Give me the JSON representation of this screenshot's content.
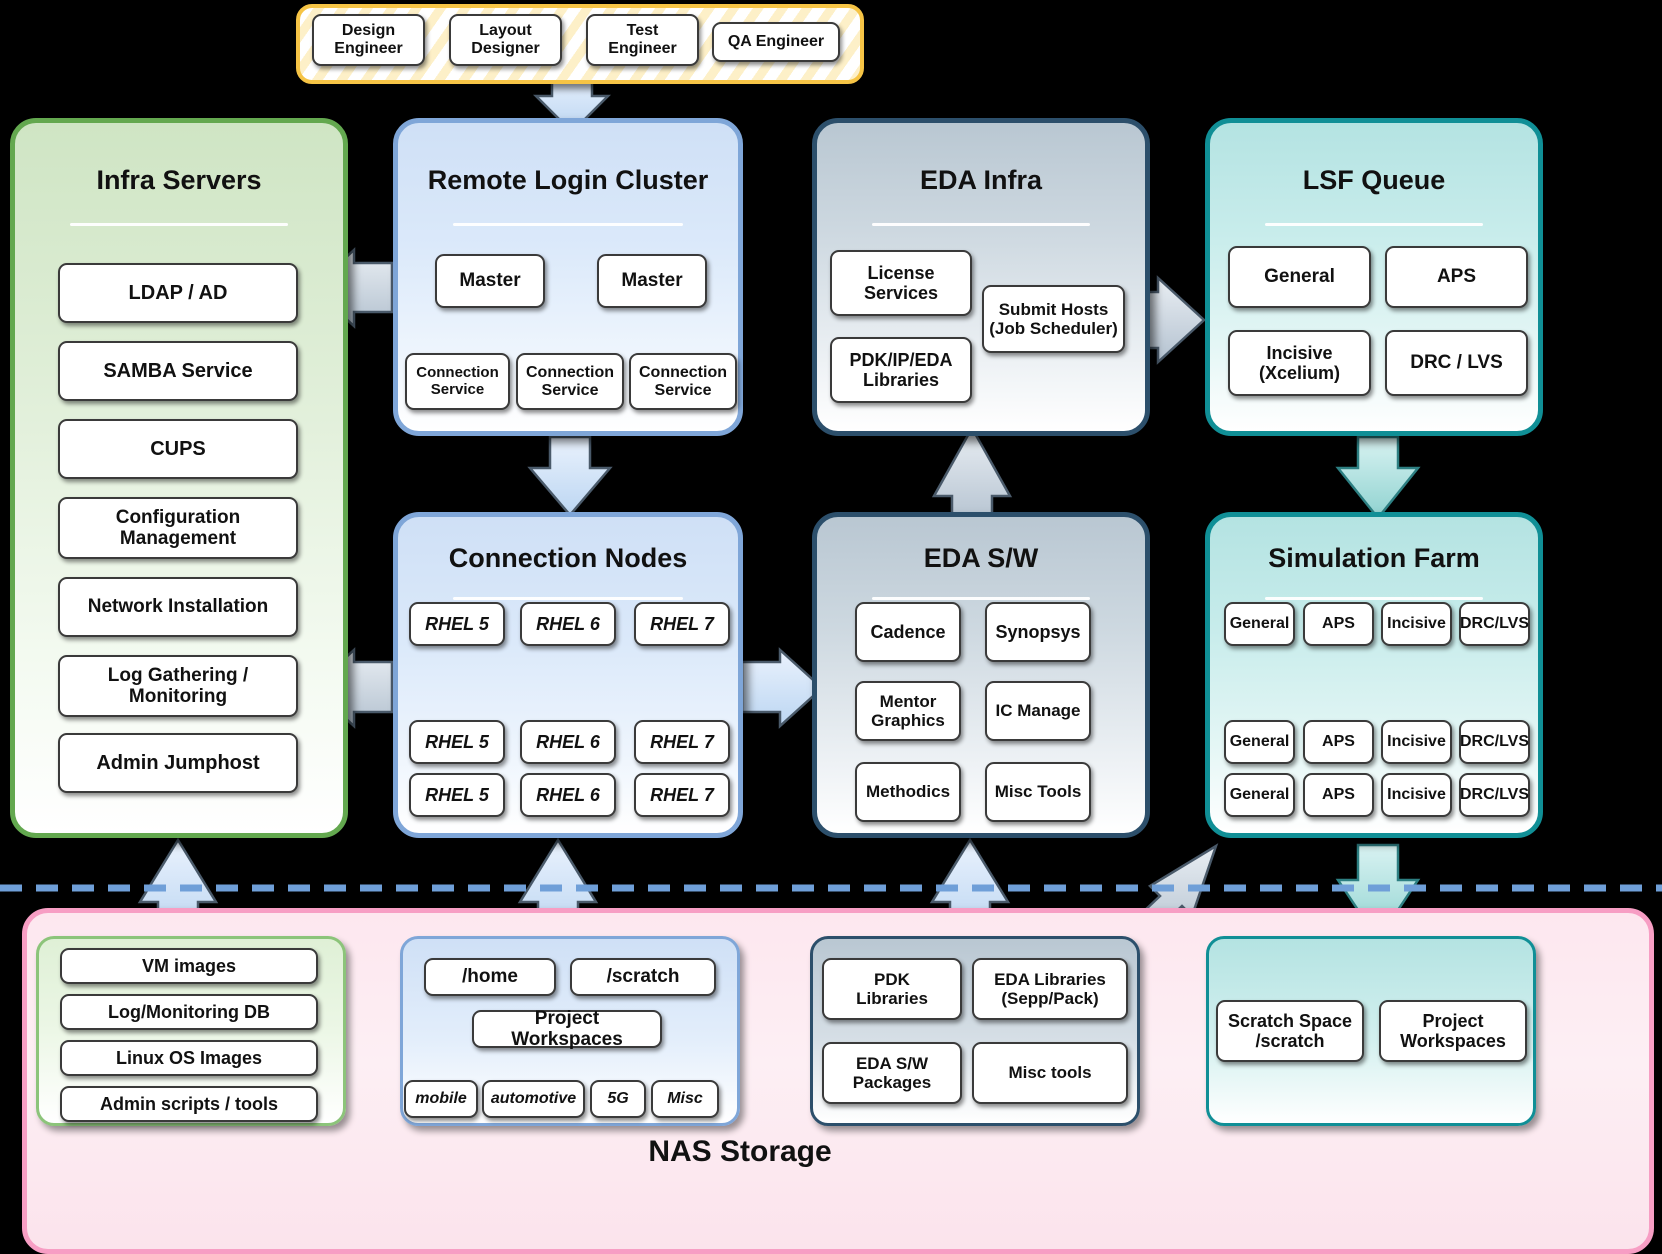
{
  "personas": {
    "items": [
      {
        "label": "Design\nEngineer"
      },
      {
        "label": "Layout\nDesigner"
      },
      {
        "label": "Test\nEngineer"
      },
      {
        "label": "QA Engineer"
      }
    ]
  },
  "panels": {
    "infra_servers": {
      "title": "Infra Servers",
      "items": [
        "LDAP / AD",
        "SAMBA Service",
        "CUPS",
        "Configuration\nManagement",
        "Network Installation",
        "Log Gathering /\nMonitoring",
        "Admin Jumphost"
      ]
    },
    "remote_login_cluster": {
      "title": "Remote Login Cluster",
      "masters": [
        "Master",
        "Master"
      ],
      "connection_services": [
        "Connection\nService",
        "Connection\nService",
        "Connection\nService"
      ]
    },
    "eda_infra": {
      "title": "EDA Infra",
      "items": [
        "License\nServices",
        "PDK/IP/EDA\nLibraries",
        "Submit Hosts\n(Job Scheduler)"
      ]
    },
    "lsf_queue": {
      "title": "LSF Queue",
      "items": [
        "General",
        "APS",
        "Incisive\n(Xcelium)",
        "DRC / LVS"
      ]
    },
    "connection_nodes": {
      "title": "Connection Nodes",
      "columns": [
        {
          "nodes": [
            "RHEL 5",
            "RHEL 5",
            "RHEL 5"
          ]
        },
        {
          "nodes": [
            "RHEL 6",
            "RHEL 6",
            "RHEL 6"
          ]
        },
        {
          "nodes": [
            "RHEL 7",
            "RHEL 7",
            "RHEL 7"
          ]
        }
      ]
    },
    "eda_sw": {
      "title": "EDA S/W",
      "items": [
        "Cadence",
        "Synopsys",
        "Mentor\nGraphics",
        "IC Manage",
        "Methodics",
        "Misc Tools"
      ]
    },
    "simulation_farm": {
      "title": "Simulation Farm",
      "columns": [
        {
          "nodes": [
            "General",
            "General",
            "General"
          ]
        },
        {
          "nodes": [
            "APS",
            "APS",
            "APS"
          ]
        },
        {
          "nodes": [
            "Incisive",
            "Incisive",
            "Incisive"
          ]
        },
        {
          "nodes": [
            "DRC/LVS",
            "DRC/LVS",
            "DRC/LVS"
          ]
        }
      ]
    }
  },
  "nas": {
    "title": "NAS Storage",
    "infra_group": {
      "items": [
        "VM images",
        "Log/Monitoring DB",
        "Linux OS Images",
        "Admin scripts / tools"
      ]
    },
    "home_group": {
      "top": [
        "/home",
        "/scratch"
      ],
      "parent": "Project Workspaces",
      "children": [
        "mobile",
        "automotive",
        "5G",
        "Misc"
      ]
    },
    "eda_group": {
      "items": [
        "PDK\nLibraries",
        "EDA Libraries\n(Sepp/Pack)",
        "EDA S/W\nPackages",
        "Misc tools"
      ]
    },
    "scratch_group": {
      "items": [
        "Scratch Space\n/scratch",
        "Project\nWorkspaces"
      ]
    }
  },
  "colors": {
    "green": "#63a84f",
    "blue": "#7fa6d8",
    "slate": "#2c4f6b",
    "teal": "#108f96",
    "pink": "#f79ec4",
    "yellow": "#f6c445",
    "arrow_gray": "#c3cfdb",
    "arrow_blue": "#cfe0f6",
    "arrow_teal": "#a8dedd",
    "divider": "#6f9fd8"
  }
}
